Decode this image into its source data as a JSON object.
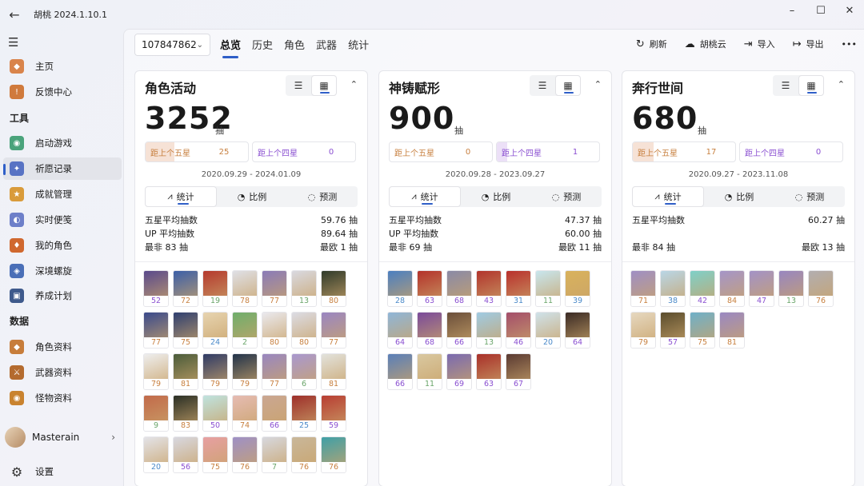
{
  "app": {
    "title": "胡桃 2024.1.10.1"
  },
  "window": {
    "minimize": "–",
    "maximize": "☐",
    "close": "✕"
  },
  "sidebar": {
    "items": [
      {
        "label": "主页",
        "icon": "home-icon",
        "color": "#d9844b"
      },
      {
        "label": "反馈中心",
        "icon": "feedback-icon",
        "color": "#d07a3c"
      },
      {
        "label": "启动游戏",
        "icon": "launch-game-icon",
        "color": "#4aa37b"
      },
      {
        "label": "祈愿记录",
        "icon": "wish-record-icon",
        "color": "#5873c4"
      },
      {
        "label": "成就管理",
        "icon": "achievement-icon",
        "color": "#d99b3b"
      },
      {
        "label": "实时便笺",
        "icon": "realtime-note-icon",
        "color": "#6d7fc9"
      },
      {
        "label": "我的角色",
        "icon": "my-character-icon",
        "color": "#d0682f"
      },
      {
        "label": "深境螺旋",
        "icon": "spiral-abyss-icon",
        "color": "#4a6fb7"
      },
      {
        "label": "养成计划",
        "icon": "cultivation-icon",
        "color": "#3e5a8c"
      },
      {
        "label": "角色资料",
        "icon": "character-wiki-icon",
        "color": "#c77d3b"
      },
      {
        "label": "武器资料",
        "icon": "weapon-wiki-icon",
        "color": "#b46b2f"
      },
      {
        "label": "怪物资料",
        "icon": "monster-wiki-icon",
        "color": "#c9832f"
      }
    ],
    "section_tools": "工具",
    "section_data": "数据",
    "user": "Masterain",
    "settings": "设置"
  },
  "toolbar": {
    "uid": "107847862",
    "tabs": [
      "总览",
      "历史",
      "角色",
      "武器",
      "统计"
    ],
    "actions": [
      {
        "label": "刷新",
        "icon": "refresh-icon",
        "glyph": "↻"
      },
      {
        "label": "胡桃云",
        "icon": "cloud-icon",
        "glyph": "☁"
      },
      {
        "label": "导入",
        "icon": "import-icon",
        "glyph": "⇥"
      },
      {
        "label": "导出",
        "icon": "export-icon",
        "glyph": "↦"
      }
    ],
    "more": "•••"
  },
  "colors": {
    "accent": "#2f5fc8",
    "five_star": "#c77f3e",
    "four_star": "#8a4fd1",
    "five_bg": "#f6e2d6",
    "four_bg": "#ece0f7"
  },
  "cards": [
    {
      "title": "角色活动",
      "total": "3252",
      "unit": "抽",
      "pity5": {
        "label": "距上个五星",
        "value": "25",
        "fill": 0.28
      },
      "pity4": {
        "label": "距上个四星",
        "value": "0",
        "fill": 0
      },
      "range": "2020.09.29 - 2024.01.09",
      "seg": [
        "统计",
        "比例",
        "预测"
      ],
      "stats": [
        {
          "label": "五星平均抽数",
          "value": "59.76 抽"
        },
        {
          "label": "UP 平均抽数",
          "value": "89.64 抽"
        }
      ],
      "extremes": {
        "worst": "最非 83 抽",
        "best": "最欧 1 抽"
      },
      "counts": [
        "52",
        "72",
        "19",
        "78",
        "77",
        "13",
        "80",
        "77",
        "75",
        "24",
        "2",
        "80",
        "80",
        "77",
        "79",
        "81",
        "79",
        "79",
        "77",
        "6",
        "81",
        "9",
        "83",
        "50",
        "74",
        "66",
        "25",
        "59",
        "20",
        "56",
        "75",
        "76",
        "7",
        "76",
        "76"
      ],
      "palette": [
        "#5a4a8c",
        "#3c5fa8",
        "#b53a2e",
        "#dfe0e6",
        "#8a7bb8",
        "#d9d9e0",
        "#2f3a2a",
        "#3a4a8c",
        "#2f3f70",
        "#e7d4b0",
        "#6fae6b",
        "#eae9ee",
        "#dcdce4",
        "#9a86c2",
        "#eeeeee",
        "#4b5c3a",
        "#2f3b66",
        "#22334a",
        "#9987c0",
        "#a998cf",
        "#e2e2dc",
        "#c26a4a",
        "#2a2f25",
        "#bfe3df",
        "#e6bcb3",
        "#caa792",
        "#9e2f2a",
        "#b83d32",
        "#e3e3e8",
        "#d8d8e0",
        "#e7a0a2",
        "#9e90c6",
        "#d7d8de",
        "#c9b79a",
        "#3fa0a7"
      ]
    },
    {
      "title": "神铸赋形",
      "total": "900",
      "unit": "抽",
      "pity5": {
        "label": "距上个五星",
        "value": "0",
        "fill": 0
      },
      "pity4": {
        "label": "距上个四星",
        "value": "1",
        "fill": 0.1
      },
      "range": "2020.09.28 - 2023.09.27",
      "seg": [
        "统计",
        "比例",
        "预测"
      ],
      "stats": [
        {
          "label": "五星平均抽数",
          "value": "47.37 抽"
        },
        {
          "label": "UP 平均抽数",
          "value": "60.00 抽"
        }
      ],
      "extremes": {
        "worst": "最非 69 抽",
        "best": "最欧 11 抽"
      },
      "counts": [
        "28",
        "63",
        "68",
        "43",
        "31",
        "11",
        "39",
        "64",
        "68",
        "66",
        "13",
        "46",
        "20",
        "64",
        "66",
        "11",
        "69",
        "63",
        "67"
      ],
      "palette": [
        "#4b7fc0",
        "#b4322a",
        "#8a8aa6",
        "#b2342c",
        "#b9302c",
        "#c8e6ee",
        "#d9b25c",
        "#8fb6d8",
        "#7a4a9a",
        "#6b4f3a",
        "#9fcbe3",
        "#a44e6a",
        "#cfe2ea",
        "#3a2a24",
        "#5a7fb8",
        "#d9c8a0",
        "#7a6ab0",
        "#a93029",
        "#5a3a32"
      ]
    },
    {
      "title": "奔行世间",
      "total": "680",
      "unit": "抽",
      "pity5": {
        "label": "距上个五星",
        "value": "17",
        "fill": 0.2
      },
      "pity4": {
        "label": "距上个四星",
        "value": "0",
        "fill": 0
      },
      "range": "2020.09.27 - 2023.11.08",
      "seg": [
        "统计",
        "比例",
        "预测"
      ],
      "stats": [
        {
          "label": "五星平均抽数",
          "value": "60.27 抽"
        }
      ],
      "extremes": {
        "worst": "最非 84 抽",
        "best": "最欧 13 抽"
      },
      "counts": [
        "71",
        "38",
        "42",
        "84",
        "47",
        "13",
        "76",
        "79",
        "57",
        "75",
        "81"
      ],
      "palette": [
        "#9f8fc4",
        "#b9d6e6",
        "#7fd0c8",
        "#a595c8",
        "#a392c6",
        "#9886c0",
        "#b2aeb0",
        "#e6d8c0",
        "#5a4c2c",
        "#6fb0c8",
        "#9a88c2"
      ]
    }
  ],
  "count_colors": {
    "five": "#c77f3e",
    "four": "#8a4fd1",
    "three": "#4a89c9",
    "green": "#6aa56a"
  }
}
